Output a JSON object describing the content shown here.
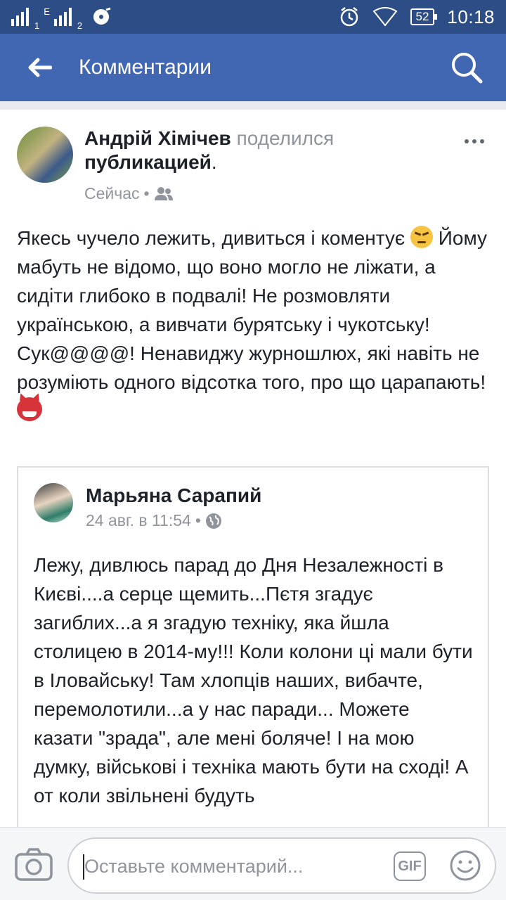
{
  "status_bar": {
    "sim1": "1",
    "network_type": "E",
    "sim2": "2",
    "battery": "52",
    "time": "10:18"
  },
  "header": {
    "title": "Комментарии"
  },
  "post": {
    "author": "Андрій Хімічев",
    "action": "поделился",
    "object": "публикацией",
    "punct": ".",
    "time": "Сейчас",
    "text_part1": "Якесь чучело лежить, дивиться і коментує ",
    "text_part2": " Йому мабуть не відомо, що воно могло не ліжати, а сидіти глибоко в подвалі! Не розмовляти українською, а вивчати бурятську і чукотську! Сук@@@@! Ненавиджу журношлюх, які навіть не розуміють одного відсотка того, про що царапають!",
    "emoji1": "angry-face",
    "emoji2": "devil-face"
  },
  "shared_post": {
    "author": "Марьяна Сарапий",
    "time": "24 авг. в 11:54",
    "text": "Лежу, дивлюсь парад до Дня Незалежності в Києві....а серце щемить...Пєтя згадує загиблих...а я згадую техніку, яка йшла столицею в 2014-му!!! Коли колони ці мали бути в Іловайську! Там хлопців наших, вибачте, перемолотили...а у нас паради... Можете казати \"зрада\", але мені боляче! І на мою думку, військові і техніка мають бути на сході! А от коли звільнені будуть"
  },
  "comment_bar": {
    "placeholder": "Оставьте комментарий...",
    "gif_label": "GIF"
  },
  "colors": {
    "status_bar": "#2c4d86",
    "nav_bar": "#4267b2",
    "text": "#1d2129",
    "meta": "#90949c"
  }
}
